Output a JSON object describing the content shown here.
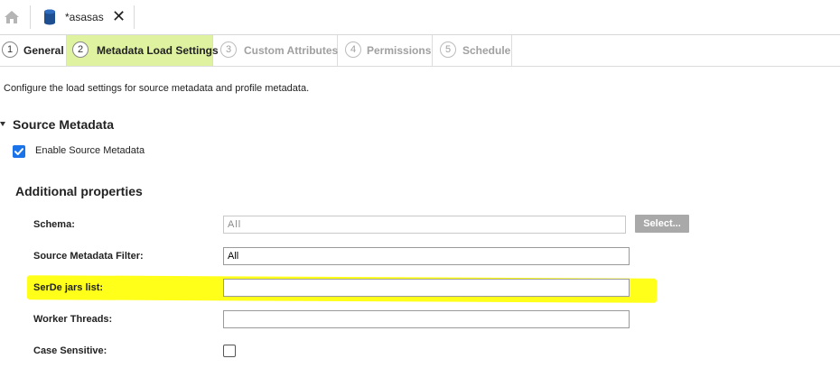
{
  "topbar": {
    "home_icon": "home-icon",
    "doc_icon": "database-icon",
    "doc_tab_title": "*asasas",
    "close_glyph": "✕"
  },
  "steps": [
    {
      "num": "1",
      "label": "General",
      "state": "normal"
    },
    {
      "num": "2",
      "label": "Metadata Load Settings",
      "state": "active"
    },
    {
      "num": "3",
      "label": "Custom Attributes",
      "state": "disabled"
    },
    {
      "num": "4",
      "label": "Permissions",
      "state": "disabled"
    },
    {
      "num": "5",
      "label": "Schedule",
      "state": "disabled"
    }
  ],
  "description": "Configure the load settings for source metadata and profile metadata.",
  "section": {
    "title": "Source Metadata",
    "expanded": true,
    "enable_label": "Enable Source Metadata",
    "enable_checked": true
  },
  "additional": {
    "title": "Additional properties",
    "schema_label": "Schema:",
    "schema_value": "All",
    "select_button": "Select...",
    "filter_label": "Source Metadata Filter:",
    "filter_value": "All",
    "serde_label": "SerDe jars list:",
    "serde_value": "",
    "threads_label": "Worker Threads:",
    "threads_value": "",
    "case_label": "Case Sensitive:",
    "case_checked": false
  },
  "colors": {
    "active_step": "#dff2a0",
    "checkbox_blue": "#1a73e8",
    "highlight": "#ffff1a",
    "db_icon": "#1d4f91"
  }
}
